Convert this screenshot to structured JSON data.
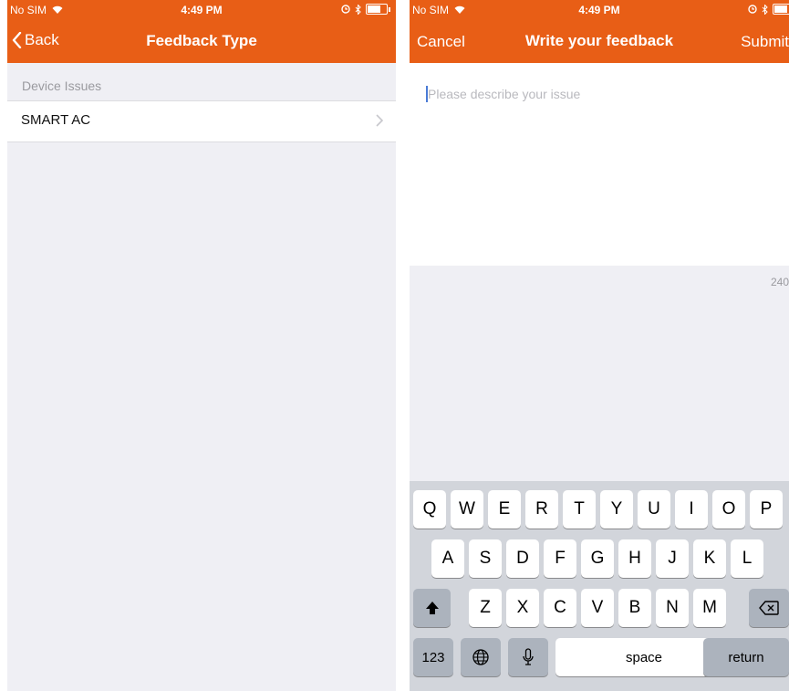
{
  "left_screen": {
    "status": {
      "carrier": "No SIM",
      "time": "4:49 PM"
    },
    "nav": {
      "back_label": "Back",
      "title": "Feedback Type"
    },
    "section_header": "Device Issues",
    "rows": [
      {
        "label": "SMART AC"
      }
    ]
  },
  "right_screen": {
    "status": {
      "carrier": "No SIM",
      "time": "4:49 PM"
    },
    "nav": {
      "cancel_label": "Cancel",
      "title": "Write your feedback",
      "submit_label": "Submit"
    },
    "input": {
      "placeholder": "Please describe your issue"
    },
    "char_counter": "240",
    "keyboard": {
      "row1": [
        "Q",
        "W",
        "E",
        "R",
        "T",
        "Y",
        "U",
        "I",
        "O",
        "P"
      ],
      "row2": [
        "A",
        "S",
        "D",
        "F",
        "G",
        "H",
        "J",
        "K",
        "L"
      ],
      "row3": [
        "Z",
        "X",
        "C",
        "V",
        "B",
        "N",
        "M"
      ],
      "numbers_label": "123",
      "space_label": "space",
      "return_label": "return"
    }
  },
  "colors": {
    "brand": "#e85e16",
    "background": "#efeff4",
    "keyboard": "#d2d5db",
    "cursor": "#4a7bd6"
  },
  "icons": [
    "wifi-icon",
    "alarm-icon",
    "bluetooth-icon",
    "battery-icon",
    "back-chevron-icon",
    "chevron-right-icon",
    "shift-icon",
    "delete-icon",
    "globe-icon",
    "microphone-icon"
  ]
}
